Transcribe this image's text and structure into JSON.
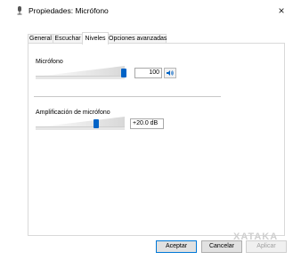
{
  "window": {
    "title": "Propiedades: Micrófono",
    "close_glyph": "×",
    "title_icon": "microphone-icon"
  },
  "tabs": [
    {
      "label": "General"
    },
    {
      "label": "Escuchar"
    },
    {
      "label": "Niveles",
      "active": true
    },
    {
      "label": "Opciones avanzadas"
    }
  ],
  "levels": {
    "microphone": {
      "label": "Micrófono",
      "value": "100",
      "level_fraction": 1.0,
      "speaker_icon": "speaker-icon"
    },
    "boost": {
      "label": "Amplificación de micrófono",
      "value": "+20.0 dB",
      "level_fraction": 0.667
    }
  },
  "buttons": {
    "accept": "Aceptar",
    "cancel": "Cancelar",
    "apply": "Aplicar"
  },
  "watermark": "XATAKA",
  "colors": {
    "thumb": "#0063c6",
    "default_button_border": "#0078d7"
  }
}
